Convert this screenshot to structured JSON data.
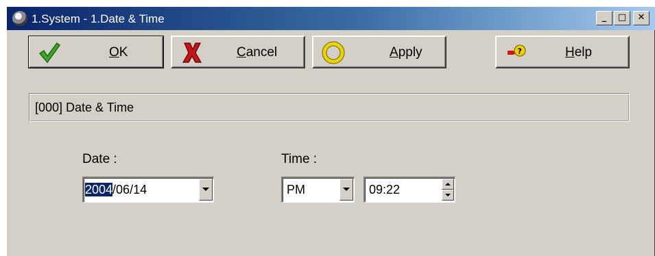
{
  "window": {
    "title": "1.System - 1.Date & Time",
    "controls": {
      "minimize": "_",
      "maximize": "□",
      "close": "✕"
    }
  },
  "toolbar": {
    "ok_label": "OK",
    "cancel_label": "Cancel",
    "apply_label": "Apply",
    "help_label": "Help"
  },
  "header": {
    "label": "[000] Date & Time"
  },
  "date": {
    "label": "Date :",
    "value_selected": "2004",
    "value_rest": "/06/14"
  },
  "time": {
    "label": "Time :",
    "ampm": "PM",
    "value": "09:22"
  },
  "icons": {
    "ok": "checkmark-icon",
    "cancel": "x-icon",
    "apply": "ring-icon",
    "help": "help-icon",
    "app": "globe-icon"
  }
}
